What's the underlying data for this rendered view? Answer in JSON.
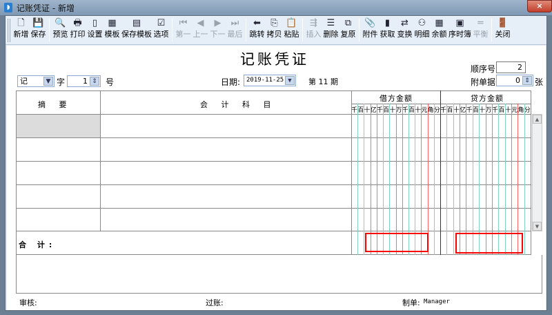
{
  "window": {
    "title": "记账凭证 - 新增",
    "close": "×"
  },
  "toolbar": {
    "groups": [
      [
        {
          "label": "新增",
          "icon": "new-doc-icon",
          "g": "🗋"
        },
        {
          "label": "保存",
          "icon": "save-icon",
          "g": "💾"
        }
      ],
      [
        {
          "label": "预览",
          "icon": "preview-icon",
          "g": "🔍"
        },
        {
          "label": "打印",
          "icon": "print-icon",
          "g": "🖶"
        },
        {
          "label": "设置",
          "icon": "settings-icon",
          "g": "▯"
        },
        {
          "label": "模板",
          "icon": "template-icon",
          "g": "▦"
        },
        {
          "label": "保存模板",
          "icon": "save-template-icon",
          "g": "▤"
        },
        {
          "label": "选项",
          "icon": "options-icon",
          "g": "☑"
        }
      ],
      [
        {
          "label": "第一",
          "icon": "first-icon",
          "g": "⏮",
          "disabled": true
        },
        {
          "label": "上一",
          "icon": "prev-icon",
          "g": "◀",
          "disabled": true
        },
        {
          "label": "下一",
          "icon": "next-icon",
          "g": "▶",
          "disabled": true
        },
        {
          "label": "最后",
          "icon": "last-icon",
          "g": "⏭",
          "disabled": true
        }
      ],
      [
        {
          "label": "跳转",
          "icon": "jump-icon",
          "g": "⬅"
        },
        {
          "label": "拷贝",
          "icon": "copy-icon",
          "g": "⎘"
        },
        {
          "label": "粘贴",
          "icon": "paste-icon",
          "g": "📋"
        }
      ],
      [
        {
          "label": "插入",
          "icon": "insert-icon",
          "g": "⇶",
          "disabled": true
        },
        {
          "label": "删除",
          "icon": "delete-icon",
          "g": "☰"
        },
        {
          "label": "复原",
          "icon": "restore-icon",
          "g": "⧉"
        }
      ],
      [
        {
          "label": "附件",
          "icon": "attachment-icon",
          "g": "📎"
        },
        {
          "label": "获取",
          "icon": "fetch-icon",
          "g": "▮"
        },
        {
          "label": "变换",
          "icon": "transform-icon",
          "g": "⇄"
        },
        {
          "label": "明细",
          "icon": "binoculars-icon",
          "g": "⚇"
        },
        {
          "label": "余额",
          "icon": "balance-icon",
          "g": "▦"
        },
        {
          "label": "序时簿",
          "icon": "journal-icon",
          "g": "▣"
        },
        {
          "label": "平衡",
          "icon": "equal-icon",
          "g": "=",
          "disabled": true
        }
      ],
      [
        {
          "label": "关闭",
          "icon": "exit-door-icon",
          "g": "🚪"
        }
      ]
    ]
  },
  "voucher": {
    "title": "记账凭证",
    "type_value": "记",
    "zi_label": "字",
    "number_value": "1",
    "hao_label": "号",
    "date_label": "日期:",
    "date_value": "2019-11-25",
    "period_text": "第 11 期",
    "seq_label": "顺序号",
    "seq_value": "2",
    "attach_label": "附单据",
    "attach_value": "0",
    "attach_unit": "张"
  },
  "table": {
    "col_summary": "摘 要",
    "col_account": "会 计 科 目",
    "col_debit": "借方金额",
    "col_credit": "贷方金额",
    "digits": [
      "千",
      "百",
      "十",
      "亿",
      "千",
      "百",
      "十",
      "万",
      "千",
      "百",
      "十",
      "元",
      "角",
      "分"
    ],
    "rows": [
      {
        "summary": "",
        "account": ""
      },
      {
        "summary": "",
        "account": ""
      },
      {
        "summary": "",
        "account": ""
      },
      {
        "summary": "",
        "account": ""
      },
      {
        "summary": "",
        "account": ""
      }
    ],
    "total_label": "合 计:"
  },
  "footer": {
    "audit_label": "审核:",
    "post_label": "过账:",
    "maker_label": "制单:",
    "maker_value": "Manager"
  },
  "colors": {
    "highlight": "#ff0000",
    "digit_line": "#7fd6c0",
    "decimal_line": "#ff6060"
  }
}
